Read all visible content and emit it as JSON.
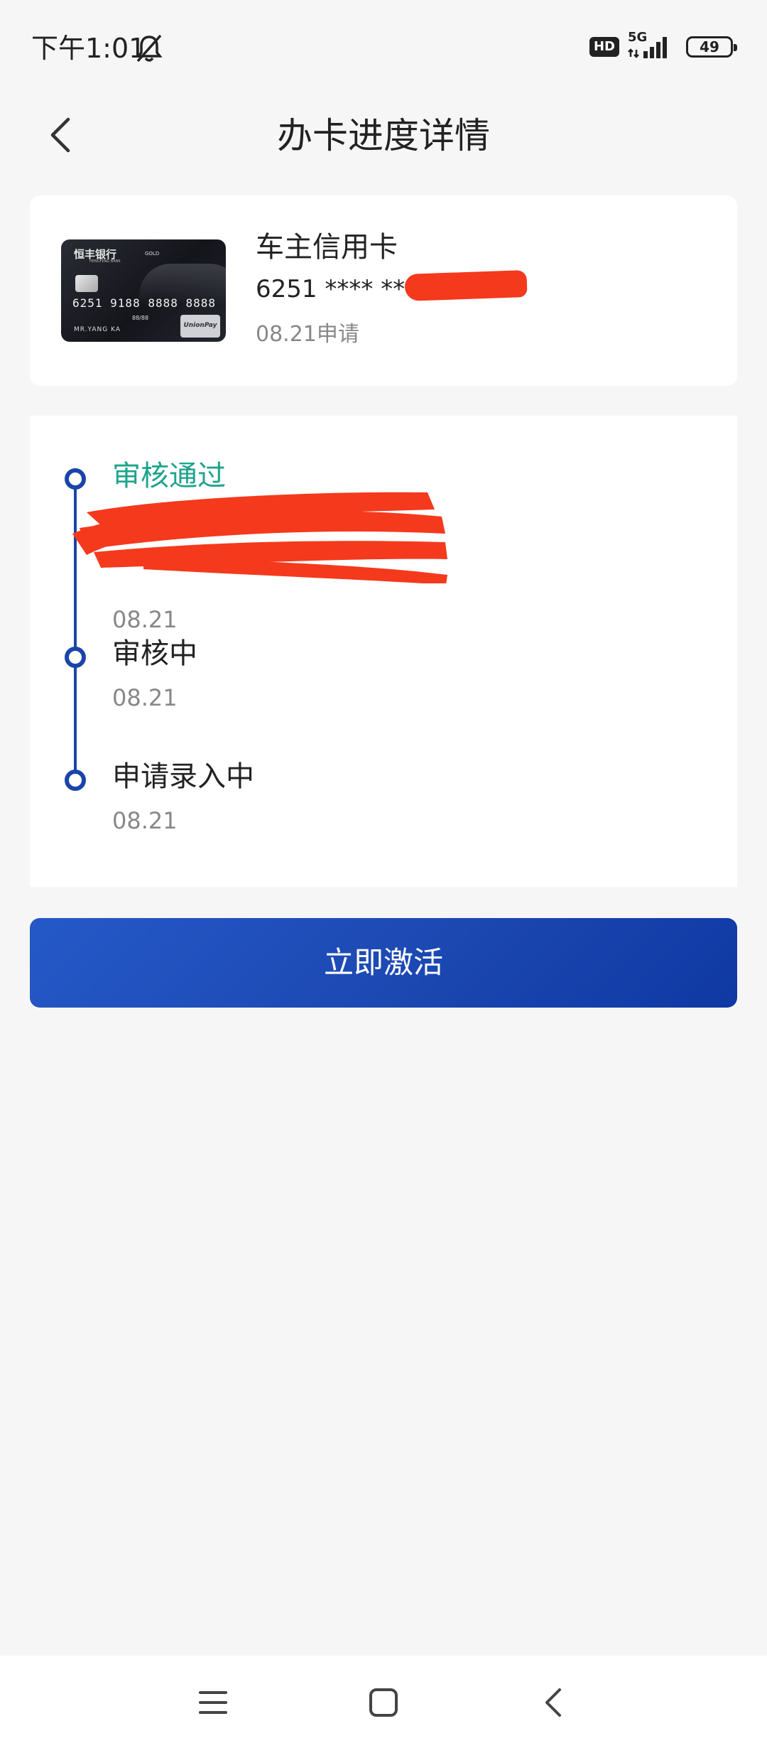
{
  "status_bar": {
    "time": "下午1:01",
    "network": "5G",
    "hd_label": "HD",
    "battery": "49",
    "icons": [
      "bell-off-icon",
      "hd-icon",
      "signal-icon",
      "battery-icon"
    ]
  },
  "header": {
    "title": "办卡进度详情",
    "back_icon": "back-arrow-icon"
  },
  "card": {
    "name": "车主信用卡",
    "number_masked": "6251 **** ****",
    "apply_date": "08.21申请",
    "image": {
      "bank": "恒丰银行",
      "bank_en": "HENGFENG BANK",
      "tier": "GOLD",
      "number": "6251 9188 8888 8888",
      "expiry": "88/88",
      "holder": "MR.YANG KA",
      "network": "UnionPay"
    }
  },
  "progress": {
    "steps": [
      {
        "title": "审核通过",
        "date": "08.21",
        "status": "active"
      },
      {
        "title": "审核中",
        "date": "08.21",
        "status": "done"
      },
      {
        "title": "申请录入中",
        "date": "08.21",
        "status": "done"
      }
    ],
    "colors": {
      "active": "#1fa38c",
      "line": "#1a45a8"
    }
  },
  "action": {
    "activate_label": "立即激活"
  },
  "nav": {
    "icons": [
      "menu-icon",
      "home-icon",
      "back-icon"
    ]
  }
}
